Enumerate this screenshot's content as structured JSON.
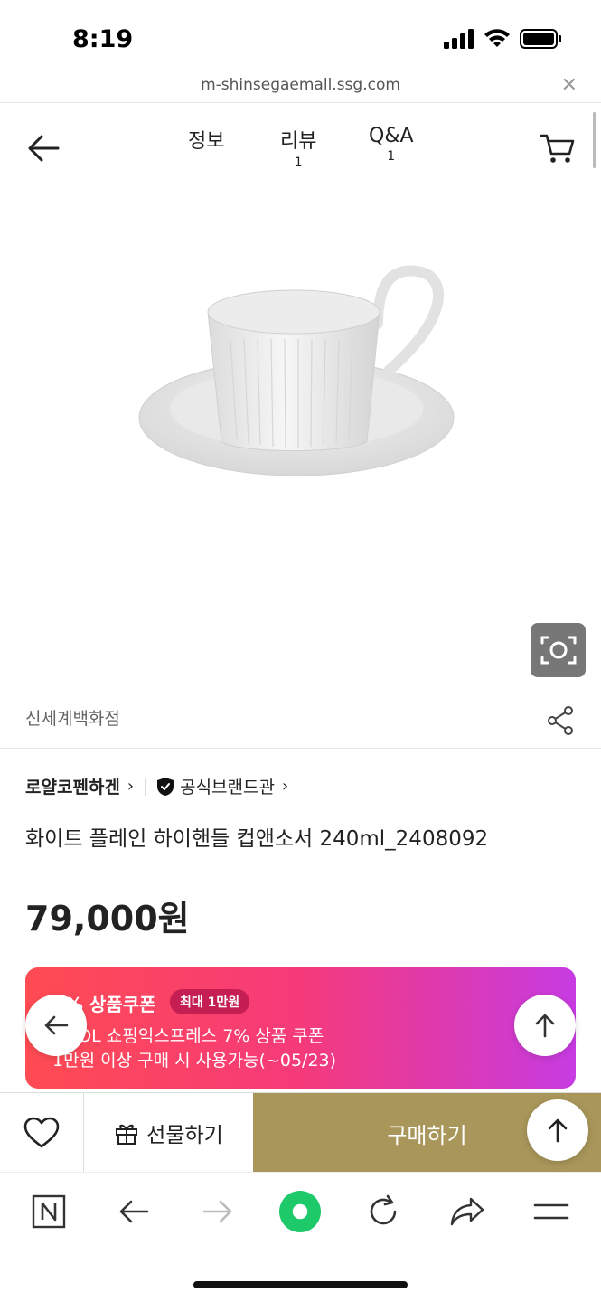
{
  "status": {
    "time": "8:19"
  },
  "url": {
    "host": "m-shinsegaemall.ssg.com"
  },
  "tabs": [
    {
      "label": "정보",
      "count": ""
    },
    {
      "label": "리뷰",
      "count": "1"
    },
    {
      "label": "Q&A",
      "count": "1"
    }
  ],
  "product": {
    "seller": "신세계백화점",
    "brand": "로얄코펜하겐",
    "official_label": "공식브랜드관",
    "title": "화이트 플레인 하이핸들 컵앤소서 240ml_2408092",
    "price": "79,000원"
  },
  "coupon": {
    "title": "7% 상품쿠폰",
    "badge": "최대 1만원",
    "line1": "COOL 쇼핑익스프레스 7% 상품 쿠폰",
    "line2": "1만원 이상 구매 시 사용가능(~05/23)"
  },
  "actions": {
    "gift_label": "선물하기",
    "buy_label": "구매하기"
  },
  "colors": {
    "buy_bg": "#a8965a",
    "coupon_start": "#ff4b52",
    "coupon_end": "#c73be2",
    "green_dot": "#1ec96a"
  }
}
